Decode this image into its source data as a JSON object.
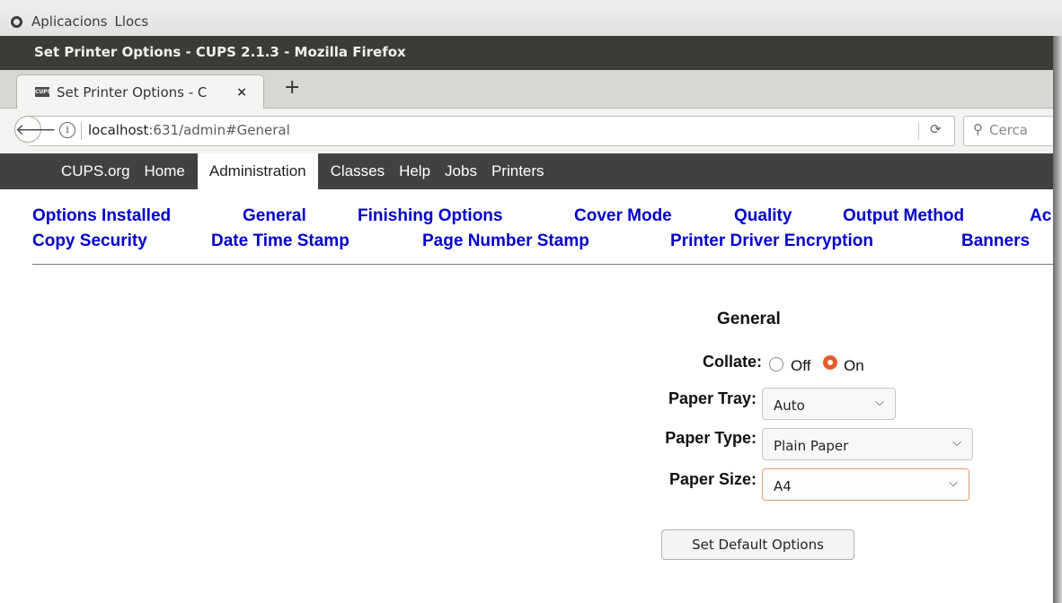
{
  "top_panel": {
    "menu": [
      "Aplicacions",
      "Llocs"
    ]
  },
  "window": {
    "title": "Set Printer Options - CUPS 2.1.3 - Mozilla Firefox"
  },
  "tab": {
    "title": "Set Printer Options - C",
    "close_glyph": "×",
    "new_tab_glyph": "+"
  },
  "urlbar": {
    "host": "localhost",
    "rest": ":631/admin#General",
    "search_placeholder": "Cerca"
  },
  "cups_nav": {
    "items": [
      "CUPS.org",
      "Home",
      "Administration",
      "Classes",
      "Help",
      "Jobs",
      "Printers"
    ],
    "active": "Administration"
  },
  "options_menu": {
    "row1": [
      "Options Installed",
      "General",
      "Finishing Options",
      "Cover Mode",
      "Quality",
      "Output Method",
      "Ac"
    ],
    "row2": [
      "Copy Security",
      "Date Time Stamp",
      "Page Number Stamp",
      "Printer Driver Encryption",
      "Banners"
    ]
  },
  "section": {
    "title": "General",
    "collate": {
      "label": "Collate:",
      "options": [
        "Off",
        "On"
      ],
      "selected": "On"
    },
    "paper_tray": {
      "label": "Paper Tray:",
      "value": "Auto"
    },
    "paper_type": {
      "label": "Paper Type:",
      "value": "Plain Paper"
    },
    "paper_size": {
      "label": "Paper Size:",
      "value": "A4"
    },
    "submit": "Set Default Options"
  },
  "colors": {
    "link": "#0000cc",
    "accent_radio": "#e65a2a",
    "cups_bar": "#414141"
  }
}
